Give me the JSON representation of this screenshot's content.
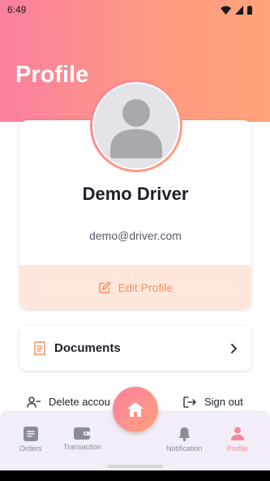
{
  "status_bar": {
    "time": "6:49"
  },
  "header": {
    "title": "Profile"
  },
  "profile": {
    "name": "Demo Driver",
    "email": "demo@driver.com",
    "edit_label": "Edit Profile"
  },
  "documents": {
    "label": "Documents"
  },
  "actions": {
    "delete_label": "Delete accou",
    "signout_label": "Sign out"
  },
  "nav": {
    "items": [
      {
        "label": "Orders",
        "icon": "orders-icon"
      },
      {
        "label": "Transaction",
        "icon": "wallet-icon"
      },
      {
        "label": "Notification",
        "icon": "bell-icon"
      },
      {
        "label": "Profile",
        "icon": "person-icon"
      }
    ],
    "active": "Profile"
  },
  "colors": {
    "gradient_start": "#fb7fa0",
    "gradient_end": "#ffa37a",
    "accent": "#f59262",
    "active_nav": "#f7879a"
  }
}
